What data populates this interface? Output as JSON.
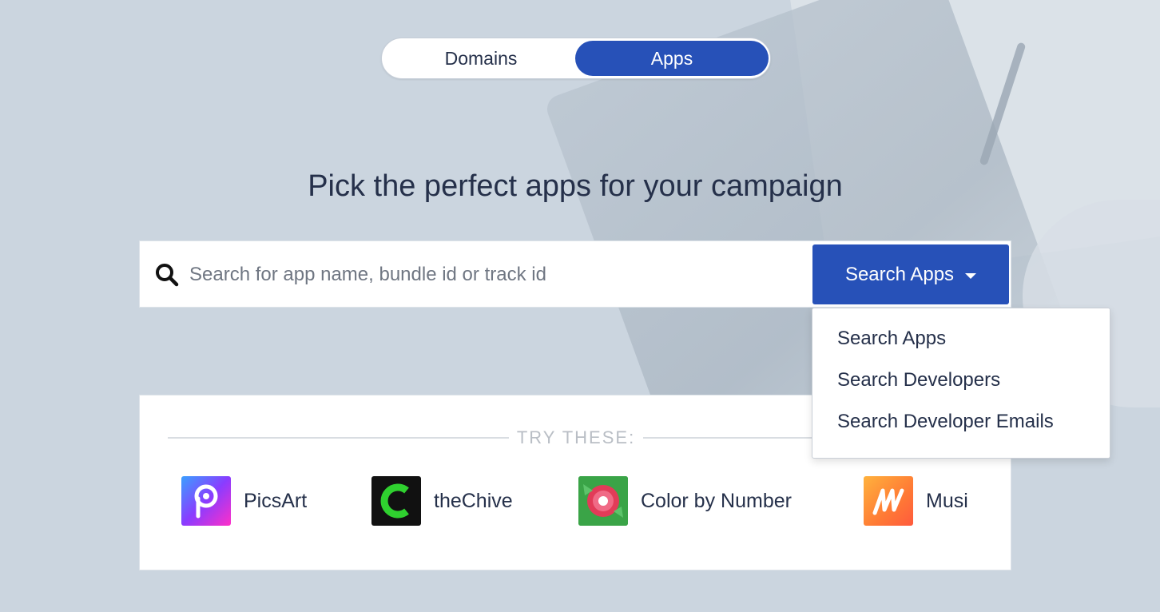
{
  "toggle": {
    "domains_label": "Domains",
    "apps_label": "Apps",
    "active": "Apps"
  },
  "headline": "Pick the perfect apps for your campaign",
  "search": {
    "placeholder": "Search for app name, bundle id or track id",
    "value": "",
    "button_label": "Search Apps"
  },
  "dropdown": {
    "items": [
      {
        "label": "Search Apps"
      },
      {
        "label": "Search Developers"
      },
      {
        "label": "Search Developer Emails"
      }
    ]
  },
  "try_these": {
    "title": "TRY THESE:",
    "apps": [
      {
        "name": "PicsArt",
        "icon": "picsart-icon"
      },
      {
        "name": "theChive",
        "icon": "thechive-icon"
      },
      {
        "name": "Color by Number",
        "icon": "color-by-number-icon"
      },
      {
        "name": "Musi",
        "icon": "musi-icon"
      }
    ]
  },
  "colors": {
    "accent": "#2751b8",
    "background": "#cbd5df",
    "text": "#25304a"
  }
}
